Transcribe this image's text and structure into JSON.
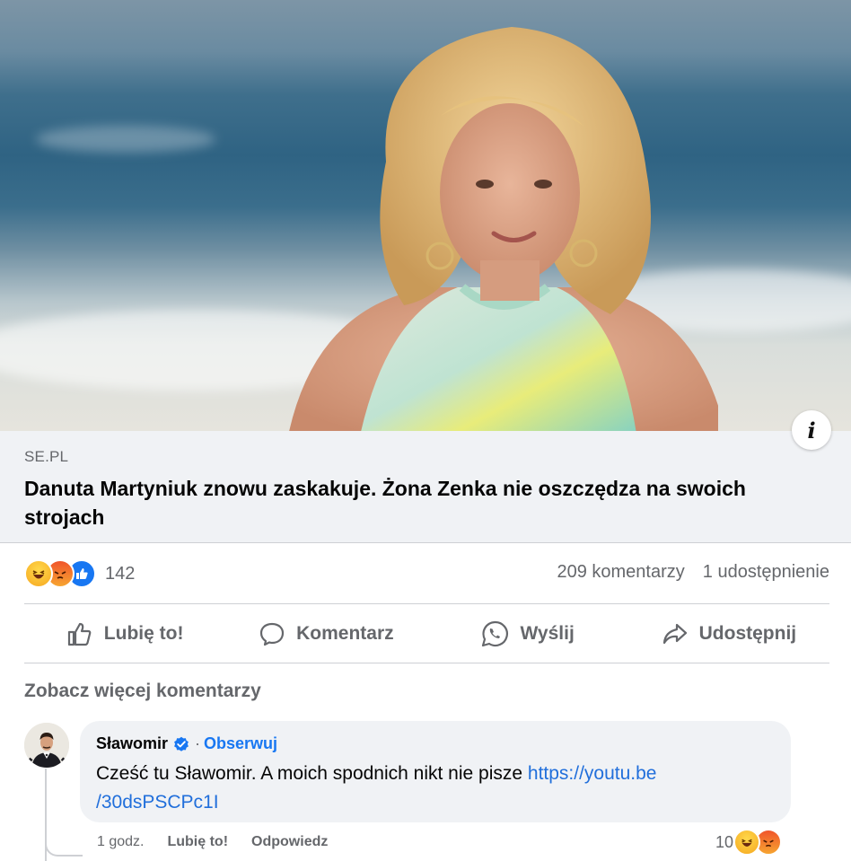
{
  "post": {
    "link_card": {
      "domain": "SE.PL",
      "headline": "Danuta Martyniuk znowu zaskakuje. Żona Zenka nie oszczędza na swoich strojach",
      "info_icon": "info-icon"
    },
    "reactions": {
      "types": [
        "haha",
        "angry",
        "like"
      ],
      "count": "142"
    },
    "comments_count": "209 komentarzy",
    "shares_count": "1 udostępnienie",
    "actions": [
      {
        "label": "Lubię to!",
        "icon": "thumbs-up-icon"
      },
      {
        "label": "Komentarz",
        "icon": "comment-icon"
      },
      {
        "label": "Wyślij",
        "icon": "whatsapp-icon"
      },
      {
        "label": "Udostępnij",
        "icon": "share-icon"
      }
    ],
    "see_more_comments": "Zobacz więcej komentarzy"
  },
  "comment": {
    "author": "Sławomir",
    "dot": "·",
    "follow": "Obserwuj",
    "text": "Cześć tu Sławomir. A moich spodnich nikt nie pisze ",
    "link_line1": "https://youtu.be",
    "link_line2": "/30dsPSCPc1I",
    "time": "1 godz.",
    "like": "Lubię to!",
    "reply": "Odpowiedz",
    "reaction_count": "10",
    "reaction_types": [
      "haha",
      "angry"
    ]
  },
  "colors": {
    "accent": "#1877f2",
    "secondary_text": "#65676b",
    "card_bg": "#f0f2f5"
  }
}
